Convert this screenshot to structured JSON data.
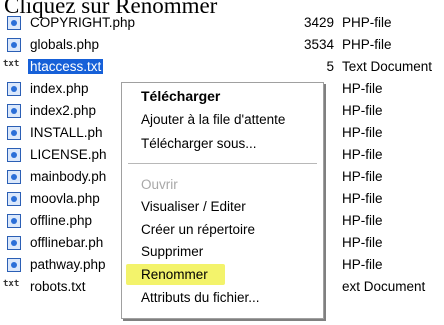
{
  "page_title": "Cliquez sur Renommer",
  "files": [
    {
      "icon": "php-file-icon",
      "name": "COPYRIGHT.php",
      "size": "3429",
      "type": "PHP-file"
    },
    {
      "icon": "php-file-icon",
      "name": "globals.php",
      "size": "3534",
      "type": "PHP-file"
    },
    {
      "icon": "text-file-icon",
      "icon_text": "txt",
      "name": "htaccess.txt",
      "size": "5",
      "type": "Text Document",
      "selected": true
    },
    {
      "icon": "php-file-icon",
      "name": "index.php",
      "size": "",
      "type": "HP-file"
    },
    {
      "icon": "php-file-icon",
      "name": "index2.php",
      "size": "",
      "type": "HP-file"
    },
    {
      "icon": "php-file-icon",
      "name": "INSTALL.ph",
      "size": "",
      "type": "HP-file"
    },
    {
      "icon": "php-file-icon",
      "name": "LICENSE.ph",
      "size": "",
      "type": "HP-file"
    },
    {
      "icon": "php-file-icon",
      "name": "mainbody.ph",
      "size": "",
      "type": "HP-file"
    },
    {
      "icon": "php-file-icon",
      "name": "moovla.php",
      "size": "",
      "type": "HP-file"
    },
    {
      "icon": "php-file-icon",
      "name": "offline.php",
      "size": "",
      "type": "HP-file"
    },
    {
      "icon": "php-file-icon",
      "name": "offlinebar.ph",
      "size": "",
      "type": "HP-file"
    },
    {
      "icon": "php-file-icon",
      "name": "pathway.php",
      "size": "",
      "type": "HP-file"
    },
    {
      "icon": "text-file-icon",
      "icon_text": "txt",
      "name": "robots.txt",
      "size": "",
      "type": "ext Document"
    }
  ],
  "context_menu": {
    "items": [
      {
        "label": "Télécharger",
        "bold": true
      },
      {
        "label": "Ajouter à la file d'attente"
      },
      {
        "label": "Télécharger sous..."
      },
      {
        "separator": true
      },
      {
        "label": "Ouvrir",
        "disabled": true
      },
      {
        "label": "Visualiser / Editer"
      },
      {
        "label": "Créer un répertoire"
      },
      {
        "label": "Supprimer"
      },
      {
        "label": "Renommer",
        "highlighted": true
      },
      {
        "label": "Attributs du fichier..."
      }
    ],
    "highlight_color": "#f3f36b"
  },
  "colors": {
    "selection": "#1660d8",
    "php_icon": "#2b6fd8"
  }
}
